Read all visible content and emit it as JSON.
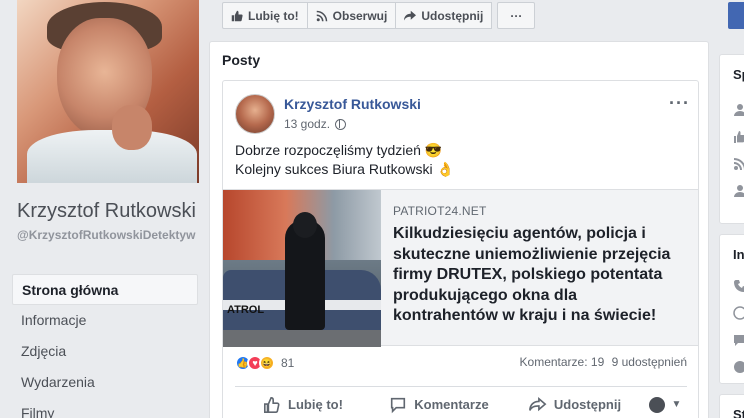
{
  "action_bar": {
    "like_label": "Lubię to!",
    "follow_label": "Obserwuj",
    "share_label": "Udostępnij",
    "more_label": "···"
  },
  "page": {
    "name": "Krzysztof Rutkowski",
    "handle": "@KrzysztofRutkowskiDetektyw"
  },
  "nav": {
    "items": [
      {
        "label": "Strona główna",
        "active": true
      },
      {
        "label": "Informacje"
      },
      {
        "label": "Zdjęcia"
      },
      {
        "label": "Wydarzenia"
      },
      {
        "label": "Filmy"
      }
    ]
  },
  "posts": {
    "title": "Posty",
    "post": {
      "author": "Krzysztof Rutkowski",
      "time": "13 godz.",
      "menu": "···",
      "text_line1": "Dobrze rozpoczęliśmy tydzień 😎",
      "text_line2": "Kolejny sukces Biura Rutkowski 👌",
      "link": {
        "domain": "PATRIOT24.NET",
        "title": "Kilkudziesięciu agentów, policja i skuteczne uniemożliwienie przejęcia firmy DRUTEX, polskiego potentata produkującego okna dla kontrahentów w kraju i na świecie!",
        "image_text": "ATROL"
      },
      "reactions_count": "81",
      "comments": "Komentarze: 19",
      "shares": "9 udostępnień",
      "actions": {
        "like": "Lubię to!",
        "comment": "Komentarze",
        "share": "Udostępnij"
      }
    }
  },
  "right": {
    "card1_title": "Sp",
    "card2_title": "In",
    "card3_title": "St"
  }
}
